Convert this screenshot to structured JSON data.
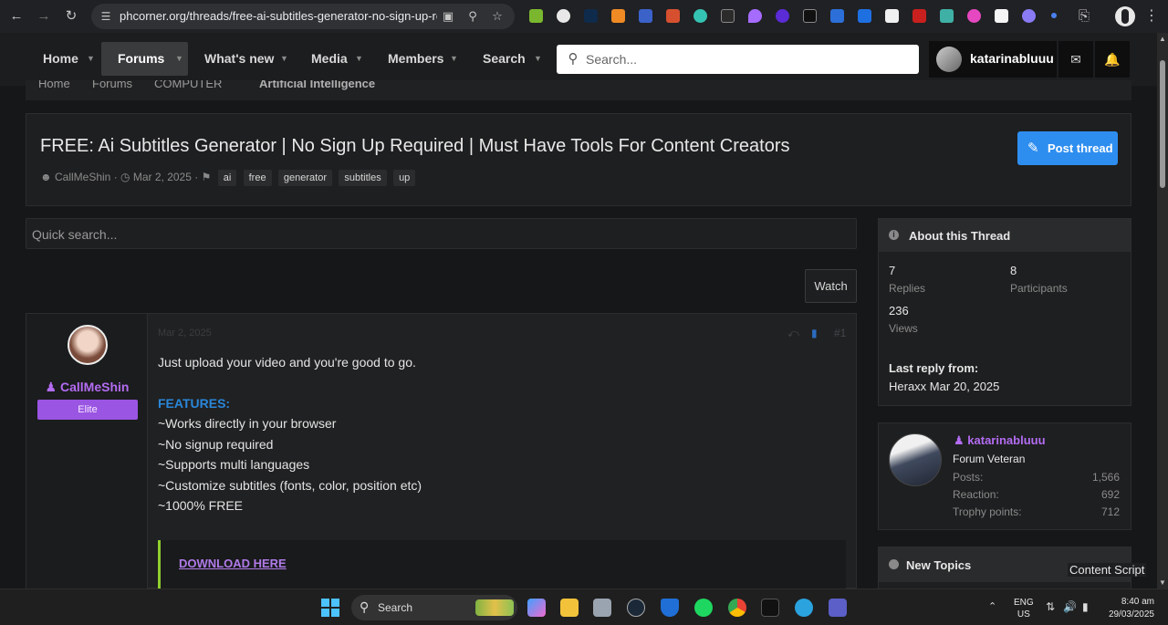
{
  "browser": {
    "url": "phcorner.org/threads/free-ai-subtitles-generator-no-sign-up-req..."
  },
  "nav": {
    "tabs": [
      {
        "label": "Home"
      },
      {
        "label": "Forums"
      },
      {
        "label": "What's new"
      },
      {
        "label": "Media"
      },
      {
        "label": "Members"
      },
      {
        "label": "Search"
      }
    ],
    "search_placeholder": "Search...",
    "username": "katarinabluuu"
  },
  "breadcrumb": [
    "Home",
    "Forums",
    "COMPUTER",
    "Artificial Intelligence"
  ],
  "thread": {
    "title": "FREE: Ai Subtitles Generator | No Sign Up Required | Must Have Tools For Content Creators",
    "post_thread_label": "Post thread",
    "author": "CallMeShin",
    "date": "Mar 2, 2025",
    "tags": [
      "ai",
      "free",
      "generator",
      "subtitles",
      "up"
    ]
  },
  "quick_search_placeholder": "Quick search...",
  "watch_label": "Watch",
  "post": {
    "username": "CallMeShin",
    "rank": "Elite",
    "date": "Mar 2, 2025",
    "number": "#1",
    "intro": "Just upload your video and you're good to go.",
    "features_heading": "FEATURES:",
    "features": [
      "~Works directly in your browser",
      "~No signup required",
      "~Supports multi languages",
      "~Customize subtitles (fonts, color, position etc)",
      "~1000% FREE"
    ],
    "download_label": "DOWNLOAD HERE"
  },
  "about": {
    "heading": "About this Thread",
    "replies_value": "7",
    "replies_label": "Replies",
    "participants_value": "8",
    "participants_label": "Participants",
    "views_value": "236",
    "views_label": "Views",
    "last_reply_label": "Last reply from:",
    "last_reply_value": "Heraxx Mar 20, 2025"
  },
  "member": {
    "name": "katarinabluuu",
    "title": "Forum Veteran",
    "rows": [
      {
        "label": "Posts:",
        "value": "1,566"
      },
      {
        "label": "Reaction:",
        "value": "692"
      },
      {
        "label": "Trophy points:",
        "value": "712"
      }
    ]
  },
  "new_topics_heading": "New Topics",
  "content_script": "Content Script",
  "taskbar": {
    "search_label": "Search",
    "lang": "ENG",
    "region": "US",
    "time": "8:40 am",
    "date": "29/03/2025"
  },
  "colors": {
    "accent_blue": "#2e8ef0",
    "username_purple": "#b36cf2",
    "features_blue": "#2a86d9",
    "quote_green": "#8fcf2e"
  }
}
